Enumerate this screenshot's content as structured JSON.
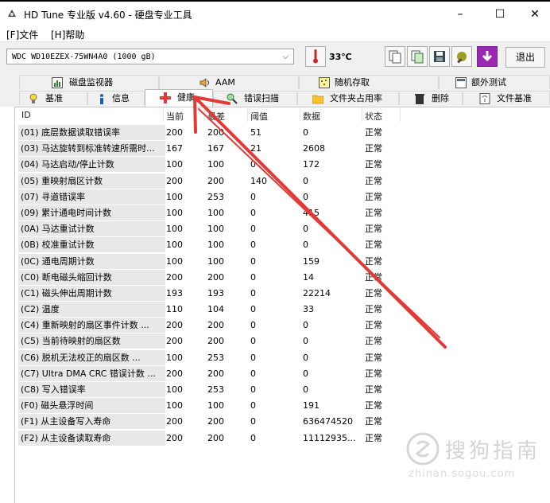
{
  "window": {
    "title": "HD Tune 专业版 v4.60 - 硬盘专业工具",
    "controls": {
      "minimize": "–",
      "maximize": "☐",
      "close": "✕"
    }
  },
  "menu": {
    "file": "[F]文件",
    "help": "[H]帮助"
  },
  "toolbar": {
    "drive": "WDC WD10EZEX-75WN4A0 (1000 gB)",
    "temperature": "33℃",
    "exit_label": "退出"
  },
  "tabs": {
    "row1": [
      "磁盘监视器",
      "AAM",
      "随机存取",
      "额外测试"
    ],
    "row2": [
      "基准",
      "信息",
      "健康",
      "错误扫描",
      "文件夹占用率",
      "删除",
      "文件基准"
    ],
    "active": "健康"
  },
  "table": {
    "headers": [
      "ID",
      "当前",
      "最差",
      "阈值",
      "数据",
      "状态"
    ],
    "rows": [
      [
        "(01) 底层数据读取错误率",
        "200",
        "200",
        "51",
        "0",
        "正常"
      ],
      [
        "(03) 马达旋转到标准转速所需时...",
        "167",
        "167",
        "21",
        "2608",
        "正常"
      ],
      [
        "(04) 马达启动/停止计数",
        "100",
        "100",
        "0",
        "172",
        "正常"
      ],
      [
        "(05) 重映射扇区计数",
        "200",
        "200",
        "140",
        "0",
        "正常"
      ],
      [
        "(07) 寻道错误率",
        "100",
        "253",
        "0",
        "0",
        "正常"
      ],
      [
        "(09) 累计通电时间计数",
        "100",
        "100",
        "0",
        "415",
        "正常"
      ],
      [
        "(0A) 马达重试计数",
        "100",
        "100",
        "0",
        "0",
        "正常"
      ],
      [
        "(0B) 校准重试计数",
        "100",
        "100",
        "0",
        "0",
        "正常"
      ],
      [
        "(0C) 通电周期计数",
        "100",
        "100",
        "0",
        "159",
        "正常"
      ],
      [
        "(C0) 断电磁头缩回计数",
        "200",
        "200",
        "0",
        "14",
        "正常"
      ],
      [
        "(C1) 磁头伸出周期计数",
        "193",
        "193",
        "0",
        "22214",
        "正常"
      ],
      [
        "(C2) 温度",
        "110",
        "104",
        "0",
        "33",
        "正常"
      ],
      [
        "(C4) 重新映射的扇区事件计数 ...",
        "200",
        "200",
        "0",
        "0",
        "正常"
      ],
      [
        "(C5) 当前待映射的扇区数",
        "200",
        "200",
        "0",
        "0",
        "正常"
      ],
      [
        "(C6) 脱机无法校正的扇区数 ...",
        "100",
        "253",
        "0",
        "0",
        "正常"
      ],
      [
        "(C7) Ultra DMA CRC 错误计数 ...",
        "200",
        "200",
        "0",
        "0",
        "正常"
      ],
      [
        "(C8) 写入错误率",
        "100",
        "253",
        "0",
        "0",
        "正常"
      ],
      [
        "(F0) 磁头悬浮时间",
        "100",
        "100",
        "0",
        "191",
        "正常"
      ],
      [
        "(F1) 从主设备写入寿命",
        "200",
        "200",
        "0",
        "636474520",
        "正常"
      ],
      [
        "(F2) 从主设备读取寿命",
        "200",
        "200",
        "0",
        "11112935...",
        "正常"
      ]
    ]
  },
  "watermark": {
    "text": "搜狗指南",
    "url": "zhinan.sogou.com"
  },
  "annotation_color": "#e53935"
}
